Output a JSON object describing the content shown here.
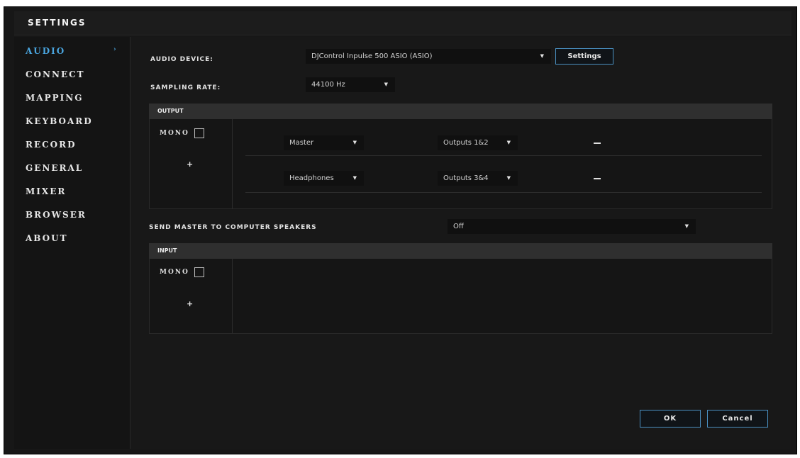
{
  "title": "SETTINGS",
  "sidebar": {
    "items": [
      {
        "label": "AUDIO"
      },
      {
        "label": "CONNECT"
      },
      {
        "label": "MAPPING"
      },
      {
        "label": "KEYBOARD"
      },
      {
        "label": "RECORD"
      },
      {
        "label": "GENERAL"
      },
      {
        "label": "MIXER"
      },
      {
        "label": "BROWSER"
      },
      {
        "label": "ABOUT"
      }
    ],
    "active_chevron": "›"
  },
  "audio_device": {
    "label": "AUDIO DEVICE:",
    "value": "DJControl Inpulse 500 ASIO (ASIO)",
    "settings_button": "Settings"
  },
  "sampling_rate": {
    "label": "SAMPLING RATE:",
    "value": "44100 Hz"
  },
  "output": {
    "header": "OUTPUT",
    "mono_label": "MONO",
    "add_label": "+",
    "rows": [
      {
        "channel": "Master",
        "outputs": "Outputs 1&2"
      },
      {
        "channel": "Headphones",
        "outputs": "Outputs 3&4"
      }
    ]
  },
  "send_master": {
    "label": "SEND MASTER TO COMPUTER SPEAKERS",
    "value": "Off"
  },
  "input": {
    "header": "INPUT",
    "mono_label": "MONO",
    "add_label": "+"
  },
  "footer": {
    "ok": "OK",
    "cancel": "Cancel"
  },
  "icons": {
    "dropdown": "dropdown-arrow-icon",
    "remove": "minus-icon",
    "add": "plus-icon",
    "chevron": "chevron-right-icon"
  },
  "colors": {
    "accent": "#4aa6e0",
    "button_border": "#4a90c2",
    "background": "#171717"
  }
}
